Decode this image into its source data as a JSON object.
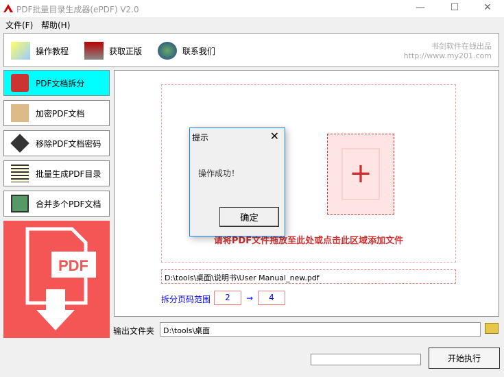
{
  "window": {
    "title": "PDF批量目录生成器(ePDF) V2.0",
    "minimize": "—",
    "maximize": "☐",
    "close": "✕"
  },
  "menu": [
    "文件(F)",
    "帮助(H)"
  ],
  "toolbar": {
    "items": [
      "操作教程",
      "获取正版",
      "联系我们"
    ],
    "brand_line1": "书剑软件在线出品",
    "brand_line2": "http://www.my201.com"
  },
  "sidebar": [
    "PDF文档拆分",
    "加密PDF文档",
    "移除PDF文档密码",
    "批量生成PDF目录",
    "合并多个PDF文档"
  ],
  "panel_logo": "PDF",
  "drop": {
    "plus": "+",
    "hint": "请将PDF文件拖放至此处或点击此区域添加文件"
  },
  "file_path": "D:\\tools\\桌面\\说明书\\User Manual_new.pdf",
  "range": {
    "label": "拆分页码范围",
    "from": "2",
    "arrow": "→",
    "to": "4"
  },
  "output": {
    "label": "输出文件夹",
    "path": "D:\\tools\\桌面"
  },
  "progress": 0,
  "start_button": "开始执行",
  "dialog": {
    "title": "提示",
    "close": "✕",
    "message": "操作成功！",
    "ok": "确定"
  }
}
